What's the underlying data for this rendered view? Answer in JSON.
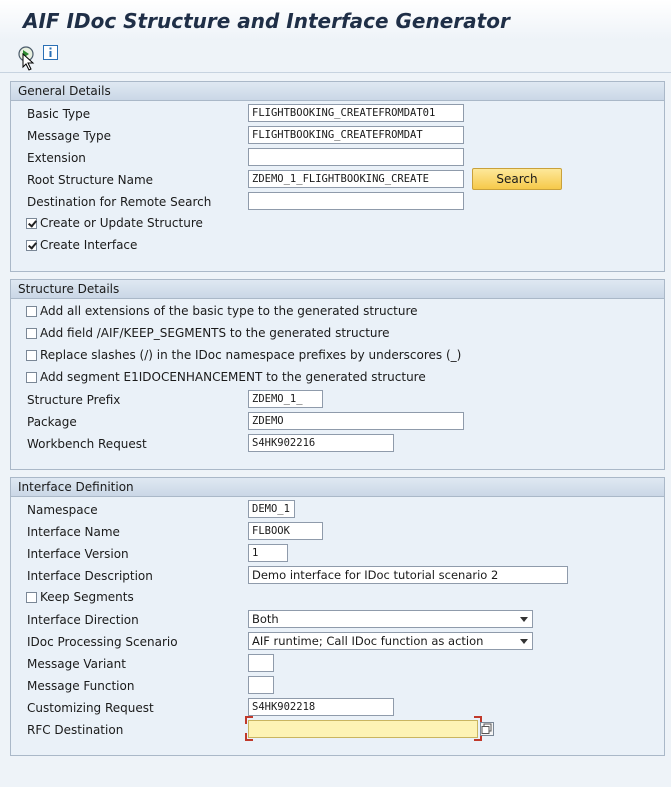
{
  "window": {
    "title": "AIF IDoc Structure and Interface Generator"
  },
  "toolbar": {
    "execute_icon": "execute-icon",
    "info_icon": "info-icon"
  },
  "general": {
    "header": "General Details",
    "basic_type_label": "Basic Type",
    "basic_type_value": "FLIGHTBOOKING_CREATEFROMDAT01",
    "message_type_label": "Message Type",
    "message_type_value": "FLIGHTBOOKING_CREATEFROMDAT",
    "extension_label": "Extension",
    "extension_value": "",
    "root_structure_label": "Root Structure Name",
    "root_structure_value": "ZDEMO_1_FLIGHTBOOKING_CREATE",
    "search_button": "Search",
    "destination_label": "Destination for Remote Search",
    "destination_value": "",
    "create_structure_label": "Create or Update Structure",
    "create_structure_checked": true,
    "create_interface_label": "Create Interface",
    "create_interface_checked": true
  },
  "structure": {
    "header": "Structure Details",
    "opt_extensions_label": "Add all extensions of the basic type to the generated structure",
    "opt_keep_segments_label": "Add field /AIF/KEEP_SEGMENTS to the generated structure",
    "opt_replace_slashes_label": "Replace slashes (/) in the IDoc namespace prefixes by underscores (_)",
    "opt_e1idoc_label": "Add segment E1IDOCENHANCEMENT to the generated structure",
    "prefix_label": "Structure Prefix",
    "prefix_value": "ZDEMO_1_",
    "package_label": "Package",
    "package_value": "ZDEMO",
    "workbench_label": "Workbench Request",
    "workbench_value": "S4HK902216"
  },
  "interface": {
    "header": "Interface Definition",
    "namespace_label": "Namespace",
    "namespace_value": "DEMO_1",
    "name_label": "Interface Name",
    "name_value": "FLBOOK",
    "version_label": "Interface Version",
    "version_value": "1",
    "description_label": "Interface Description",
    "description_value": "Demo interface for IDoc tutorial scenario 2",
    "keep_segments_label": "Keep Segments",
    "direction_label": "Interface Direction",
    "direction_value": "Both",
    "scenario_label": "IDoc Processing Scenario",
    "scenario_value": "AIF runtime; Call IDoc function as action",
    "variant_label": "Message Variant",
    "variant_value": "",
    "function_label": "Message Function",
    "function_value": "",
    "customizing_label": "Customizing Request",
    "customizing_value": "S4HK902218",
    "rfc_label": "RFC Destination",
    "rfc_value": ""
  }
}
